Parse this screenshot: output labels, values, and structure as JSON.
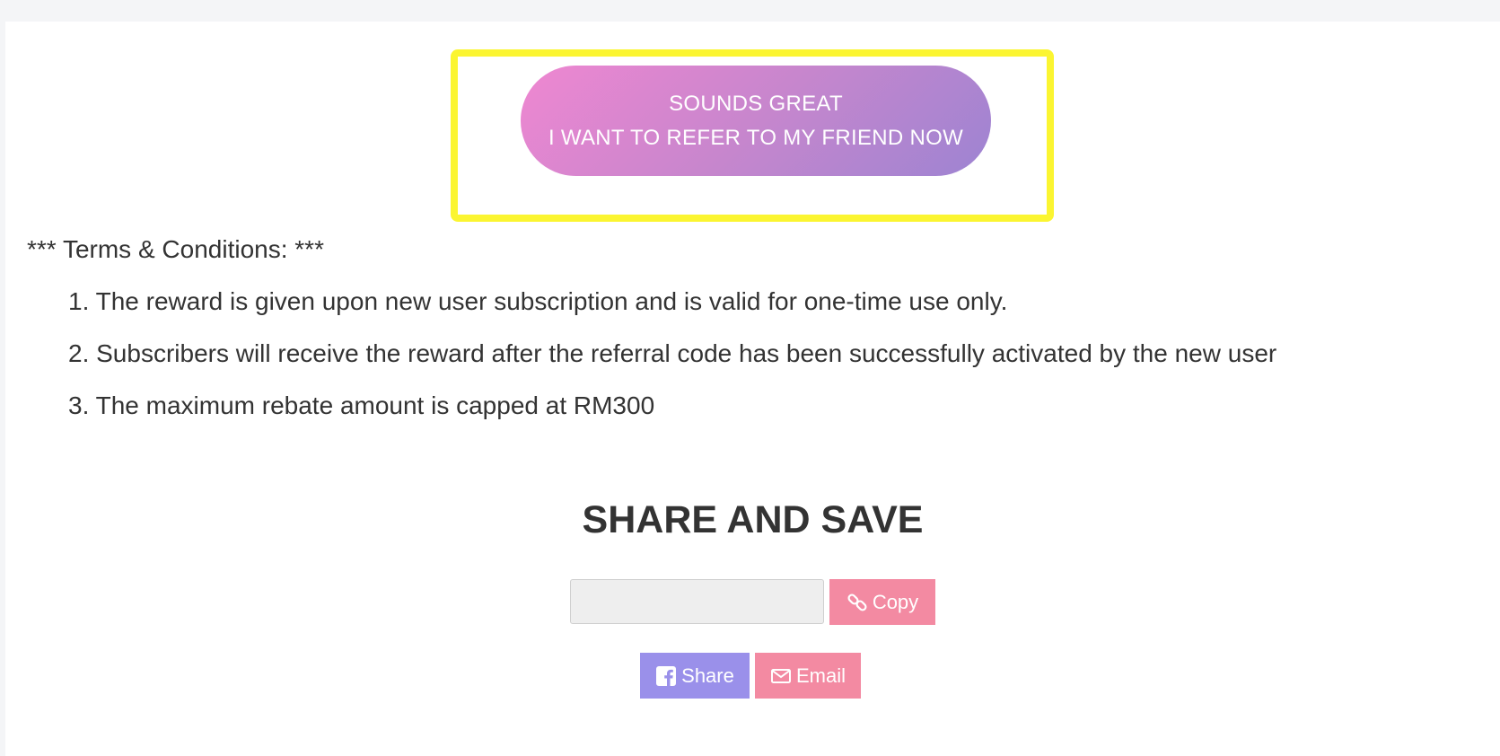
{
  "cta": {
    "line1": "SOUNDS GREAT",
    "line2": "I WANT TO REFER TO MY FRIEND NOW"
  },
  "terms": {
    "title": "*** Terms & Conditions: ***",
    "items": [
      "1. The reward is given upon new user subscription and is valid for one-time use only.",
      "2. Subscribers will receive the reward after the referral code has been successfully activated by the new user",
      "3. The maximum rebate amount is capped at RM300"
    ]
  },
  "share": {
    "heading": "SHARE AND SAVE",
    "link_value": "",
    "copy_label": "Copy",
    "copy_icon": "link-icon",
    "share_label": "Share",
    "share_icon": "facebook-icon",
    "email_label": "Email",
    "email_icon": "envelope-icon"
  },
  "colors": {
    "highlight": "#fbf531",
    "cta_gradient_start": "#ef87d1",
    "cta_gradient_end": "#9d84d2",
    "pink": "#f38aa2",
    "purple": "#9a90ea"
  }
}
